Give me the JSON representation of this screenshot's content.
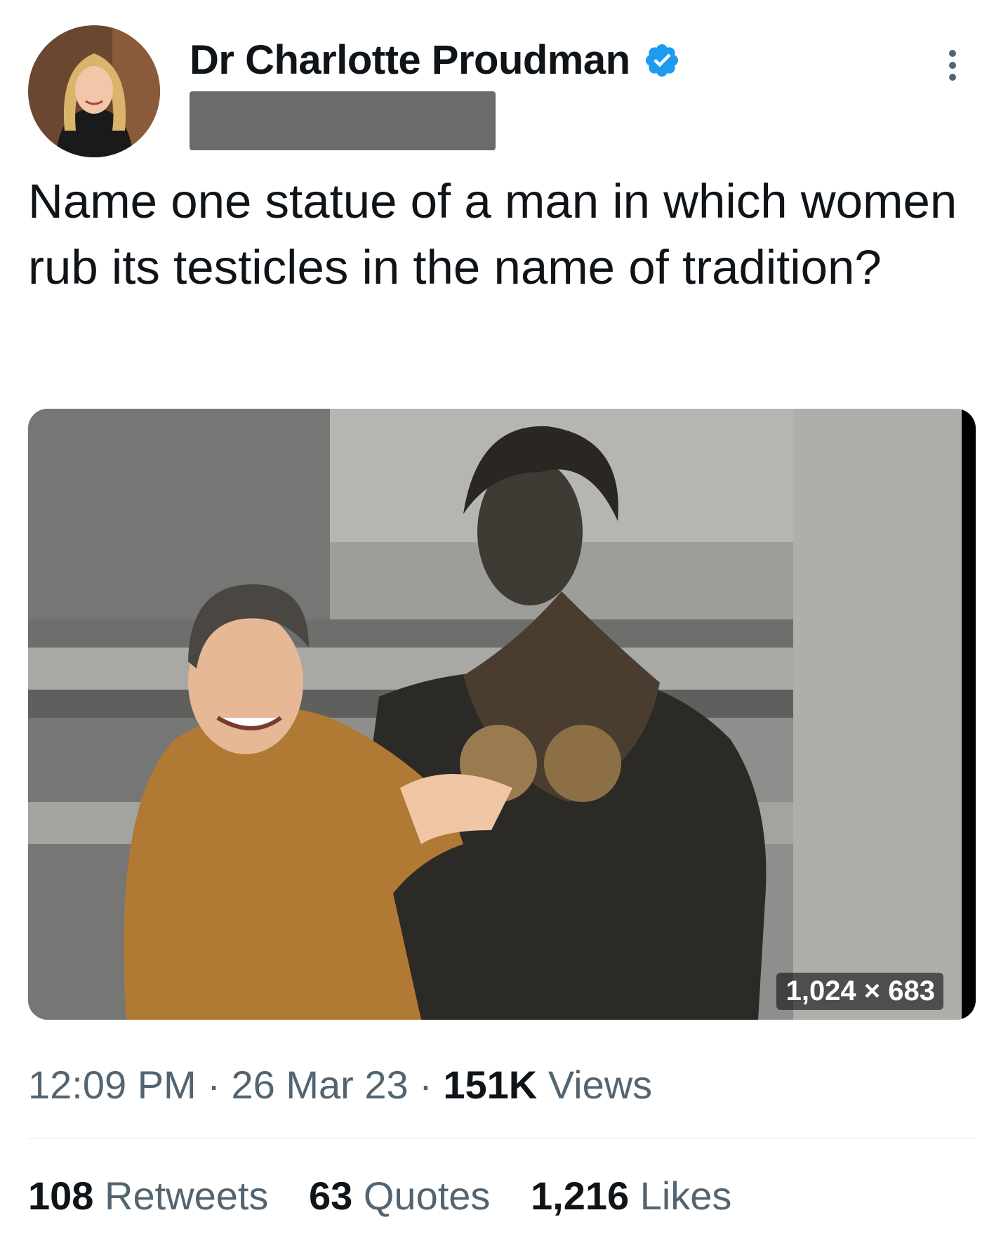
{
  "author": {
    "display_name": "Dr Charlotte Proudman",
    "verified": true,
    "handle_redacted": true
  },
  "tweet": {
    "text": "Name one statue of a man in which women rub its testicles in the name of tradition?"
  },
  "media": {
    "dimensions_label": "1,024 × 683"
  },
  "meta": {
    "time": "12:09 PM",
    "separator": " · ",
    "date": "26 Mar 23",
    "views_count": "151K",
    "views_label": "Views"
  },
  "stats": {
    "retweets_count": "108",
    "retweets_label": "Retweets",
    "quotes_count": "63",
    "quotes_label": "Quotes",
    "likes_count": "1,216",
    "likes_label": "Likes"
  },
  "colors": {
    "text_primary": "#0f1419",
    "text_secondary": "#536471",
    "verified_blue": "#1d9bf0",
    "divider": "#eff3f4"
  },
  "icons": [
    "verified-badge-icon",
    "more-options-icon"
  ]
}
